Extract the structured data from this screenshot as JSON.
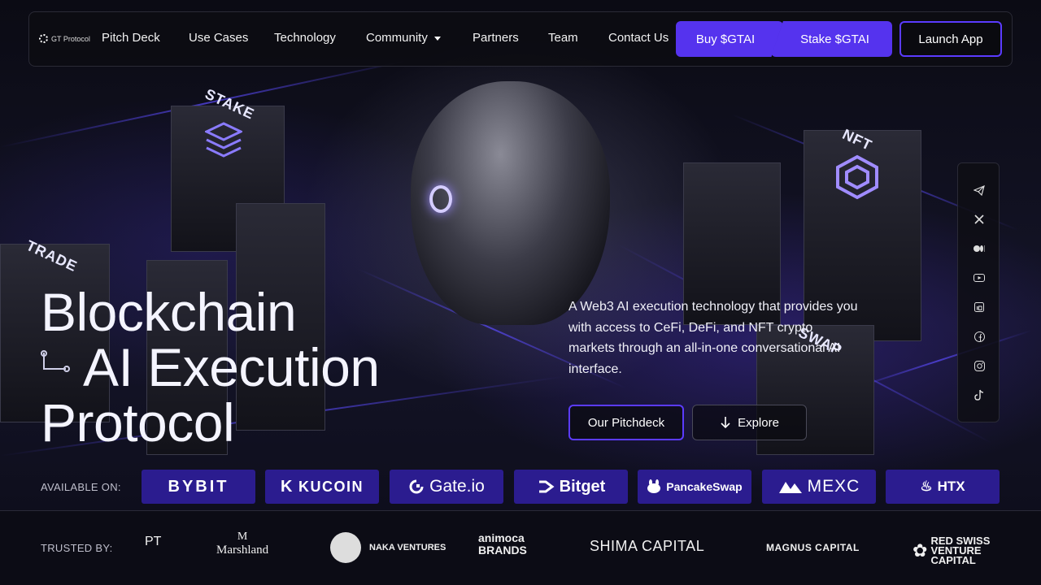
{
  "nav": {
    "logo_text": "GT Protocol",
    "links": [
      "Pitch Deck",
      "Use Cases",
      "Technology",
      "Community",
      "Partners",
      "Team",
      "Contact Us"
    ],
    "buy_label": "Buy $GTAI",
    "stake_label": "Stake $GTAI",
    "launch_label": "Launch App"
  },
  "scene": {
    "cube_labels": [
      "STAKE",
      "TRADE",
      "NFT",
      "SWAP"
    ]
  },
  "hero": {
    "title_line1": "Blockchain",
    "title_line2": "AI Execution",
    "title_line3": "Protocol",
    "description": "A Web3 AI execution technology that provides you with access to CeFi, DeFi, and NFT crypto markets through an all-in-one conversational AI interface.",
    "pitch_label": "Our Pitchdeck",
    "explore_label": "Explore"
  },
  "social": [
    "telegram-icon",
    "x-icon",
    "medium-icon",
    "youtube-icon",
    "linkedin-icon",
    "facebook-icon",
    "instagram-icon",
    "tiktok-icon"
  ],
  "available": {
    "label": "AVAILABLE ON:",
    "exchanges": [
      "BYBIT",
      "KUCOIN",
      "Gate.io",
      "Bitget",
      "PancakeSwap",
      "MEXC",
      "HTX"
    ]
  },
  "trusted": {
    "label": "TRUSTED BY:",
    "partners": [
      "PT",
      "Marshland",
      "NAKA VENTURES",
      "animoca BRANDS",
      "SHIMA CAPITAL",
      "MAGNUS CAPITAL",
      "RED SWISS VENTURE CAPITAL"
    ]
  },
  "colors": {
    "accent": "#5533ee",
    "exchange_bg": "#2b1c8f"
  }
}
